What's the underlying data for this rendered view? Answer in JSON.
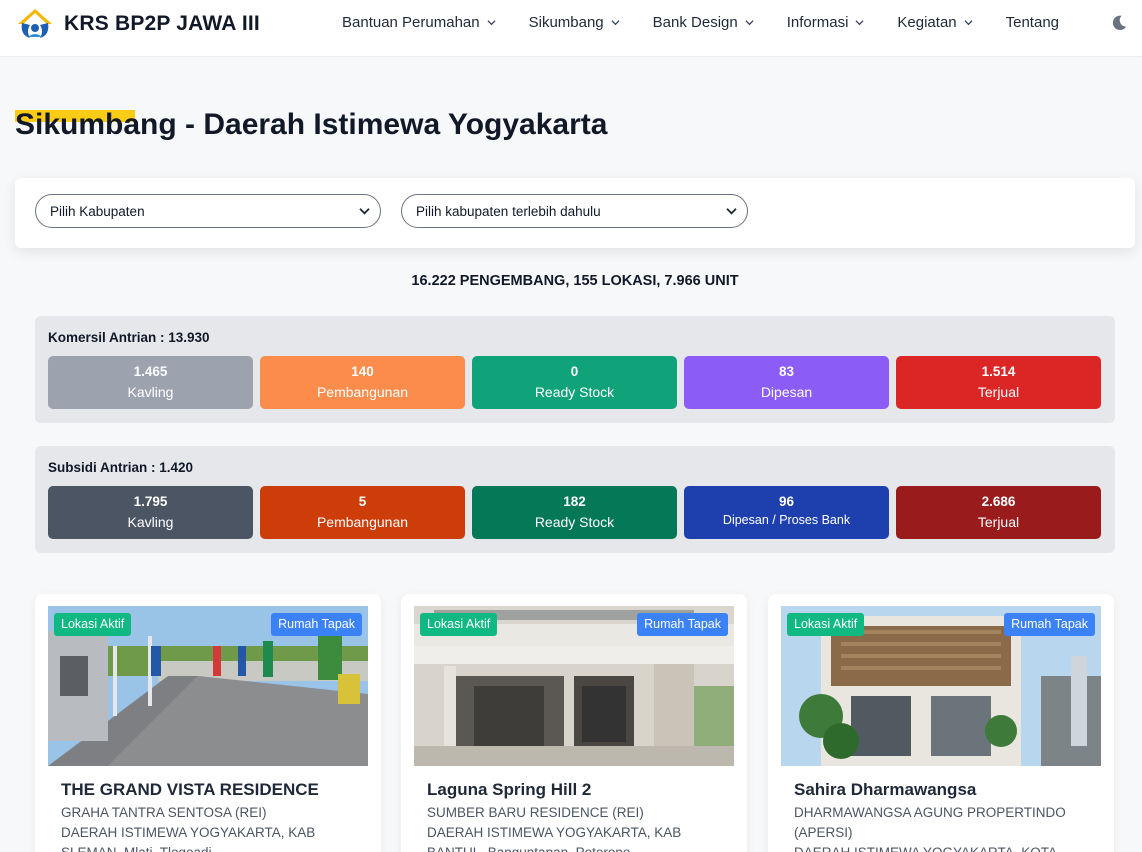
{
  "brand": {
    "name": "KRS BP2P JAWA III"
  },
  "nav": {
    "items": [
      {
        "label": "Bantuan Perumahan",
        "dropdown": true
      },
      {
        "label": "Sikumbang",
        "dropdown": true
      },
      {
        "label": "Bank Design",
        "dropdown": true
      },
      {
        "label": "Informasi",
        "dropdown": true
      },
      {
        "label": "Kegiatan",
        "dropdown": true
      },
      {
        "label": "Tentang",
        "dropdown": false
      }
    ],
    "theme_icon": "moon-icon"
  },
  "page": {
    "title": "Sikumbang - Daerah Istimewa Yogyakarta"
  },
  "filters": {
    "kabupaten": "Pilih Kabupaten",
    "kecamatan": "Pilih kabupaten terlebih dahulu"
  },
  "summary": "16.222 PENGEMBANG, 155 LOKASI, 7.966 UNIT",
  "komersil": {
    "title": "Komersil Antrian : 13.930",
    "stats": [
      {
        "value": "1.465",
        "label": "Kavling",
        "color": "#9ca3af"
      },
      {
        "value": "140",
        "label": "Pembangunan",
        "color": "#fb8c4c"
      },
      {
        "value": "0",
        "label": "Ready Stock",
        "color": "#10a37a"
      },
      {
        "value": "83",
        "label": "Dipesan",
        "color": "#8b5cf6"
      },
      {
        "value": "1.514",
        "label": "Terjual",
        "color": "#dc2626"
      }
    ]
  },
  "subsidi": {
    "title": "Subsidi Antrian : 1.420",
    "stats": [
      {
        "value": "1.795",
        "label": "Kavling",
        "color": "#4b5563"
      },
      {
        "value": "5",
        "label": "Pembangunan",
        "color": "#cc3d0a"
      },
      {
        "value": "182",
        "label": "Ready Stock",
        "color": "#047857"
      },
      {
        "value": "96",
        "label": "Dipesan / Proses Bank",
        "color": "#1e40af"
      },
      {
        "value": "2.686",
        "label": "Terjual",
        "color": "#991b1b"
      }
    ]
  },
  "cards": [
    {
      "status": "Lokasi Aktif",
      "type": "Rumah Tapak",
      "title": "THE GRAND VISTA RESIDENCE",
      "developer": "GRAHA TANTRA SENTOSA (REI)",
      "location": "DAERAH ISTIMEWA YOGYAKARTA, KAB SLEMAN, Mlati, Tlogoadi"
    },
    {
      "status": "Lokasi Aktif",
      "type": "Rumah Tapak",
      "title": "Laguna Spring Hill 2",
      "developer": "SUMBER BARU RESIDENCE (REI)",
      "location": "DAERAH ISTIMEWA YOGYAKARTA, KAB BANTUL, Banguntapan, Potorono"
    },
    {
      "status": "Lokasi Aktif",
      "type": "Rumah Tapak",
      "title": "Sahira Dharmawangsa",
      "developer": "DHARMAWANGSA AGUNG PROPERTINDO (APERSI)",
      "location": "DAERAH ISTIMEWA YOGYAKARTA, KOTA"
    }
  ]
}
